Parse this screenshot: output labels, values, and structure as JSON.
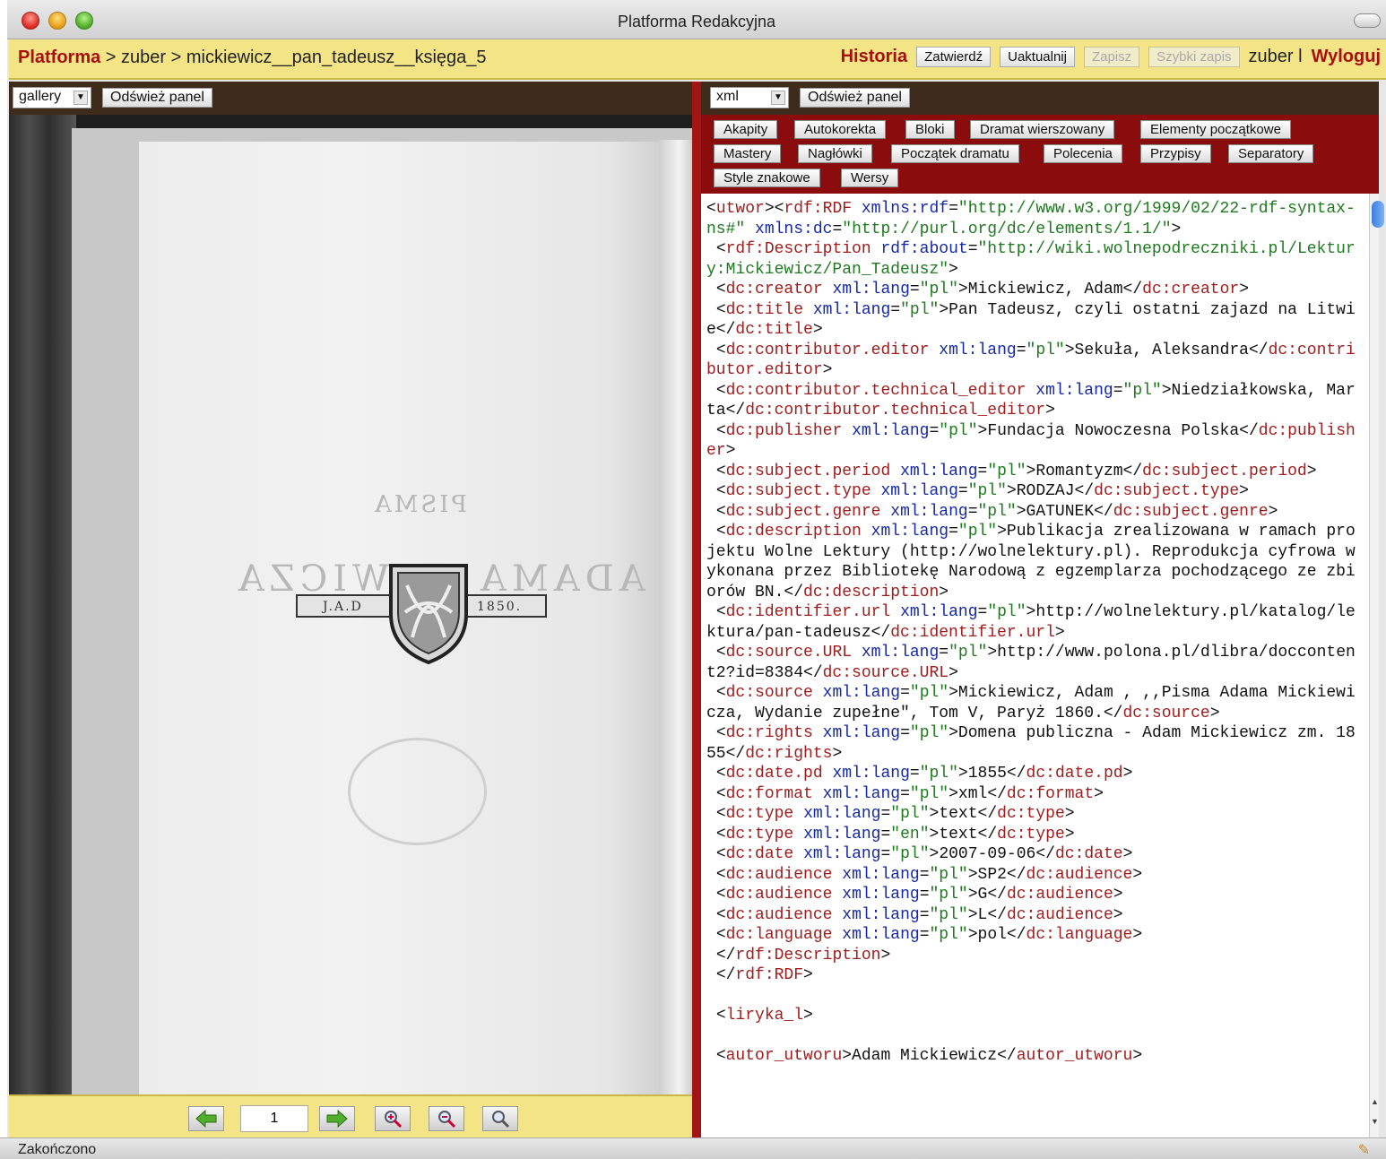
{
  "window": {
    "title": "Platforma Redakcyjna"
  },
  "header": {
    "brand": "Platforma",
    "sep1": " > ",
    "user_crumb": "zuber",
    "sep2": " > ",
    "document": "mickiewicz__pan_tadeusz__księga_5",
    "history": "Historia",
    "buttons": {
      "confirm": "Zatwierdź",
      "update": "Uaktualnij",
      "save": "Zapisz",
      "quick_save": "Szybki zapis"
    },
    "username": "zuber",
    "divider": "l",
    "logout": "Wyloguj"
  },
  "left_panel": {
    "view_select": "gallery",
    "refresh": "Odśwież panel",
    "scan": {
      "left_text": "PISMA",
      "banner_left": "J.A.D",
      "banner_right": "1850.",
      "mirror_left": "WICZA",
      "mirror_right": "ADAMA"
    },
    "page_number": "1"
  },
  "right_panel": {
    "view_select": "xml",
    "refresh": "Odśwież panel",
    "tags": [
      "Akapity",
      "Autokorekta",
      "Bloki",
      "Dramat wierszowany",
      "Elementy początkowe",
      "Mastery",
      "Nagłówki",
      "Początek dramatu",
      "Polecenia",
      "Przypisy",
      "Separatory",
      "Style znakowe",
      "Wersy"
    ]
  },
  "status": {
    "text": "Zakończono"
  },
  "icons": {
    "prev": "arrow-left-icon",
    "next": "arrow-right-icon",
    "zoom_in": "zoom-in-icon",
    "zoom_out": "zoom-out-icon",
    "zoom_reset": "zoom-reset-icon"
  },
  "colors": {
    "accent_red": "#a80f0f",
    "header_yellow": "#f3e485",
    "toolbar_brown": "#3d2c1c",
    "tag_panel_red": "#8b0c0c"
  },
  "xml_source": "<utwor><rdf:RDF xmlns:rdf=\"http://www.w3.org/1999/02/22-rdf-syntax-ns#\" xmlns:dc=\"http://purl.org/dc/elements/1.1/\">\n <rdf:Description rdf:about=\"http://wiki.wolnepodreczniki.pl/Lektury:Mickiewicz/Pan_Tadeusz\">\n <dc:creator xml:lang=\"pl\">Mickiewicz, Adam</dc:creator>\n <dc:title xml:lang=\"pl\">Pan Tadeusz, czyli ostatni zajazd na Litwie</dc:title>\n <dc:contributor.editor xml:lang=\"pl\">Sekuła, Aleksandra</dc:contributor.editor>\n <dc:contributor.technical_editor xml:lang=\"pl\">Niedziałkowska, Marta</dc:contributor.technical_editor>\n <dc:publisher xml:lang=\"pl\">Fundacja Nowoczesna Polska</dc:publisher>\n <dc:subject.period xml:lang=\"pl\">Romantyzm</dc:subject.period>\n <dc:subject.type xml:lang=\"pl\">RODZAJ</dc:subject.type>\n <dc:subject.genre xml:lang=\"pl\">GATUNEK</dc:subject.genre>\n <dc:description xml:lang=\"pl\">Publikacja zrealizowana w ramach projektu Wolne Lektury (http://wolnelektury.pl). Reprodukcja cyfrowa wykonana przez Bibliotekę Narodową z egzemplarza pochodzącego ze zbiorów BN.</dc:description>\n <dc:identifier.url xml:lang=\"pl\">http://wolnelektury.pl/katalog/lektura/pan-tadeusz</dc:identifier.url>\n <dc:source.URL xml:lang=\"pl\">http://www.polona.pl/dlibra/doccontent2?id=8384</dc:source.URL>\n <dc:source xml:lang=\"pl\">Mickiewicz, Adam , ,,Pisma Adama Mickiewicza, Wydanie zupełne\", Tom V, Paryż 1860.</dc:source>\n <dc:rights xml:lang=\"pl\">Domena publiczna - Adam Mickiewicz zm. 1855</dc:rights>\n <dc:date.pd xml:lang=\"pl\">1855</dc:date.pd>\n <dc:format xml:lang=\"pl\">xml</dc:format>\n <dc:type xml:lang=\"pl\">text</dc:type>\n <dc:type xml:lang=\"en\">text</dc:type>\n <dc:date xml:lang=\"pl\">2007-09-06</dc:date>\n <dc:audience xml:lang=\"pl\">SP2</dc:audience>\n <dc:audience xml:lang=\"pl\">G</dc:audience>\n <dc:audience xml:lang=\"pl\">L</dc:audience>\n <dc:language xml:lang=\"pl\">pol</dc:language>\n </rdf:Description>\n </rdf:RDF>\n\n <liryka_l>\n\n <autor_utworu>Adam Mickiewicz</autor_utworu>"
}
